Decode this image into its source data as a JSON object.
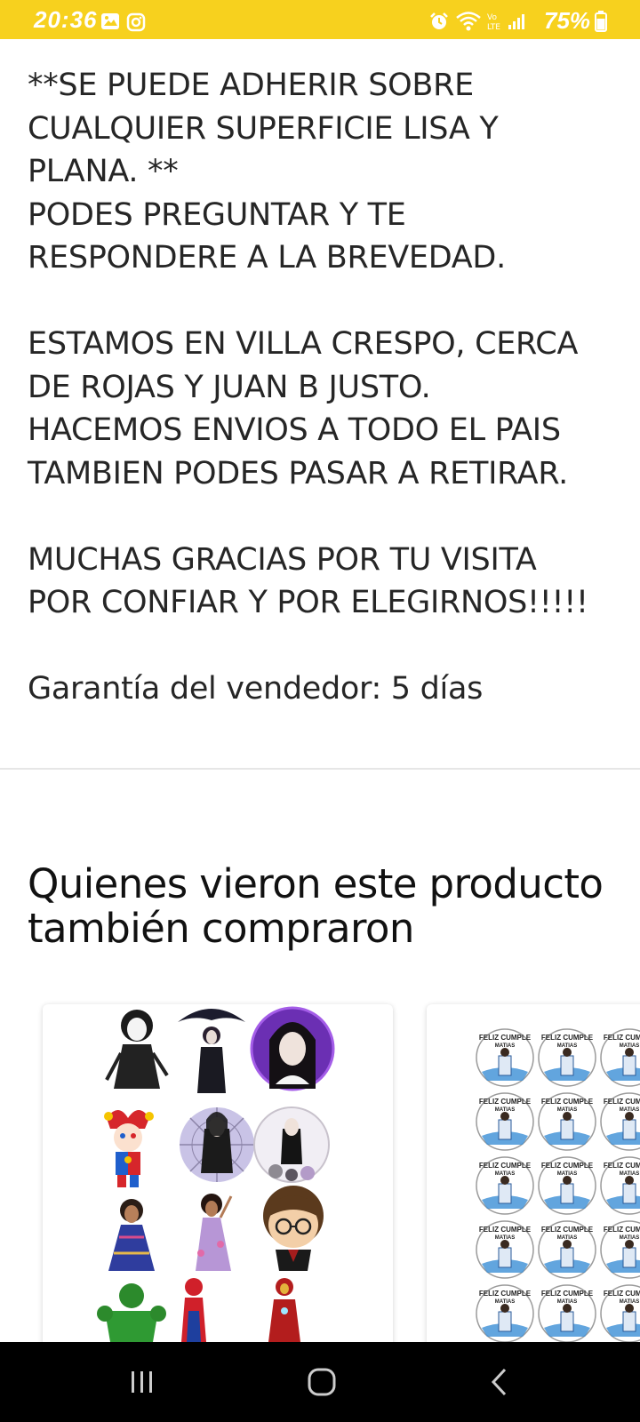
{
  "status_bar": {
    "time": "20:36",
    "battery": "75%",
    "icons": [
      "gallery-icon",
      "instagram-icon",
      "alarm-icon",
      "wifi-icon",
      "volte-icon",
      "signal-icon",
      "battery-icon"
    ]
  },
  "description": {
    "lines": [
      "**SE PUEDE ADHERIR SOBRE",
      "CUALQUIER SUPERFICIE LISA Y",
      "PLANA. **",
      "PODES PREGUNTAR Y TE",
      "RESPONDERE A LA BREVEDAD.",
      "",
      "ESTAMOS EN VILLA CRESPO, CERCA",
      "DE ROJAS Y JUAN B JUSTO.",
      "HACEMOS ENVIOS A TODO EL PAIS",
      "TAMBIEN PODES PASAR A RETIRAR.",
      "",
      "MUCHAS GRACIAS POR TU VISITA",
      "POR CONFIAR Y POR ELEGIRNOS!!!!!",
      "",
      "Garantía del vendedor: 5 días"
    ]
  },
  "related": {
    "title_line1": "Quienes vieron este producto",
    "title_line2": "también compraron",
    "card2_sticker_text_1": "FELIZ CUMPLE",
    "card2_sticker_text_2": "MATIAS"
  },
  "colors": {
    "status_bar": "#f7d11e",
    "text": "#262626",
    "nav_bar": "#000000"
  },
  "nav": {
    "icons": [
      "recent-apps-icon",
      "home-icon",
      "back-icon"
    ]
  }
}
